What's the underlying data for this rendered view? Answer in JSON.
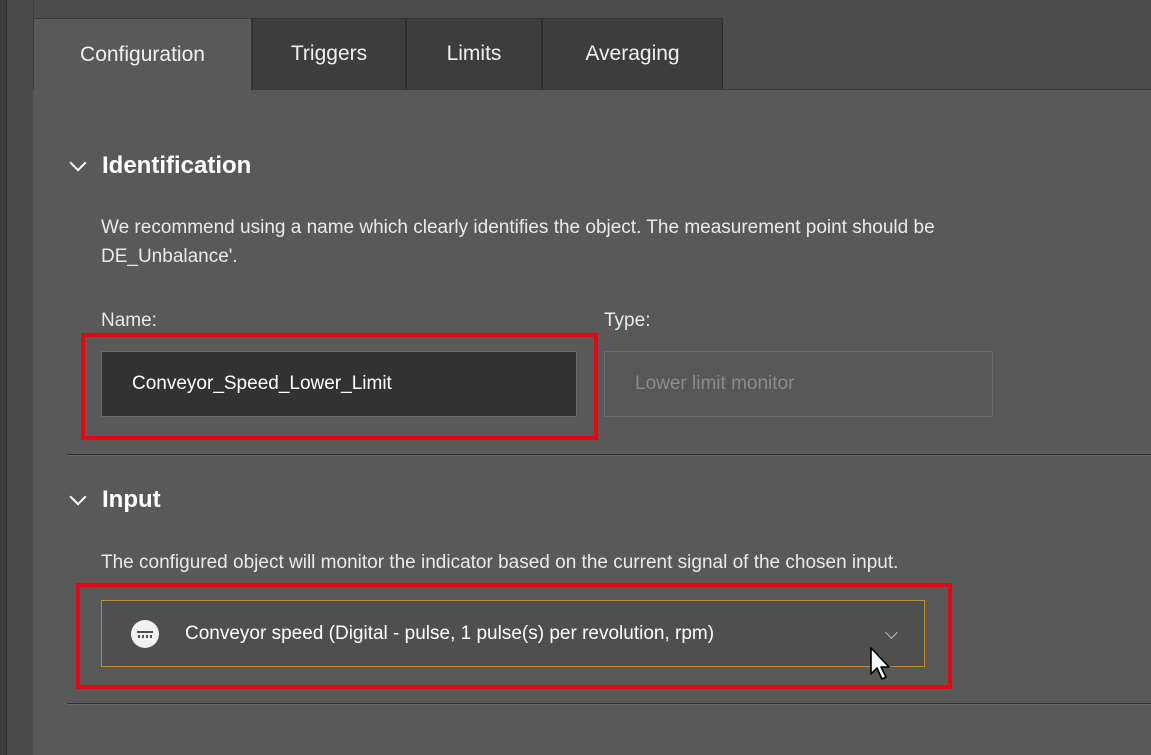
{
  "tabs": [
    {
      "label": "Configuration",
      "active": true
    },
    {
      "label": "Triggers",
      "active": false
    },
    {
      "label": "Limits",
      "active": false
    },
    {
      "label": "Averaging",
      "active": false
    }
  ],
  "identification": {
    "title": "Identification",
    "description_line1": "We recommend using a name which clearly identifies the object. The measurement point should be",
    "description_line2": "DE_Unbalance'.",
    "name_label": "Name:",
    "name_value": "Conveyor_Speed_Lower_Limit",
    "type_label": "Type:",
    "type_placeholder": "Lower limit monitor"
  },
  "input": {
    "title": "Input",
    "description": "The configured object will monitor the indicator based on the current signal of the chosen input.",
    "selected_value": "Conveyor speed (Digital - pulse, 1 pulse(s) per revolution, rpm)",
    "icon": "signal-icon"
  },
  "colors": {
    "highlight": "#e8040c",
    "select_border": "#c98a1e",
    "panel_bg": "#595959"
  }
}
